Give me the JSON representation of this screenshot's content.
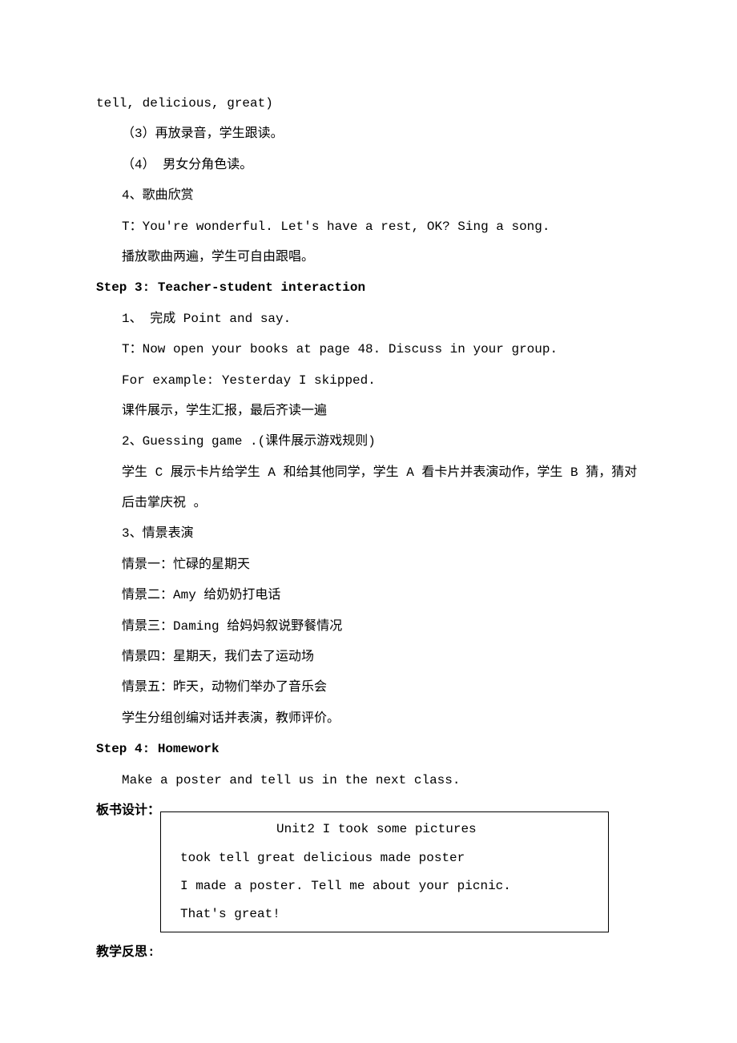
{
  "lines": {
    "l1": "tell, delicious, great)",
    "l2": "（3）再放录音，学生跟读。",
    "l3": "（4） 男女分角色读。",
    "l4": "4、歌曲欣赏",
    "l5": "T：You're wonderful. Let's have a rest, OK? Sing a song.",
    "l6": "播放歌曲两遍，学生可自由跟唱。",
    "step3": "Step 3: Teacher-student interaction",
    "l7": "1、 完成 Point and say.",
    "l8": "T：Now open your books at page 48. Discuss in your group.",
    "l9": "For example: Yesterday I skipped.",
    "l10": "课件展示，学生汇报，最后齐读一遍",
    "l11": "2、Guessing game .(课件展示游戏规则)",
    "l12": "学生 C 展示卡片给学生 A 和给其他同学，学生 A 看卡片并表演动作，学生 B 猜，猜对后击掌庆祝 。",
    "l13": "3、情景表演",
    "l14": "情景一：忙碌的星期天",
    "l15": "情景二：Amy 给奶奶打电话",
    "l16": "情景三：Daming 给妈妈叙说野餐情况",
    "l17": "情景四：星期天，我们去了运动场",
    "l18": "情景五：昨天，动物们举办了音乐会",
    "l19": "学生分组创编对话并表演，教师评价。",
    "step4": "Step 4: Homework",
    "l20": "Make a poster and tell us in the next class.",
    "boardLabel": "板书设计：",
    "board": {
      "title": "Unit2 I took some pictures",
      "row1": "took   tell   great   delicious   made   poster",
      "row2": "I made a poster.  Tell me about your picnic.",
      "row3": "That's great!"
    },
    "reflectLabel": "教学反思:"
  }
}
